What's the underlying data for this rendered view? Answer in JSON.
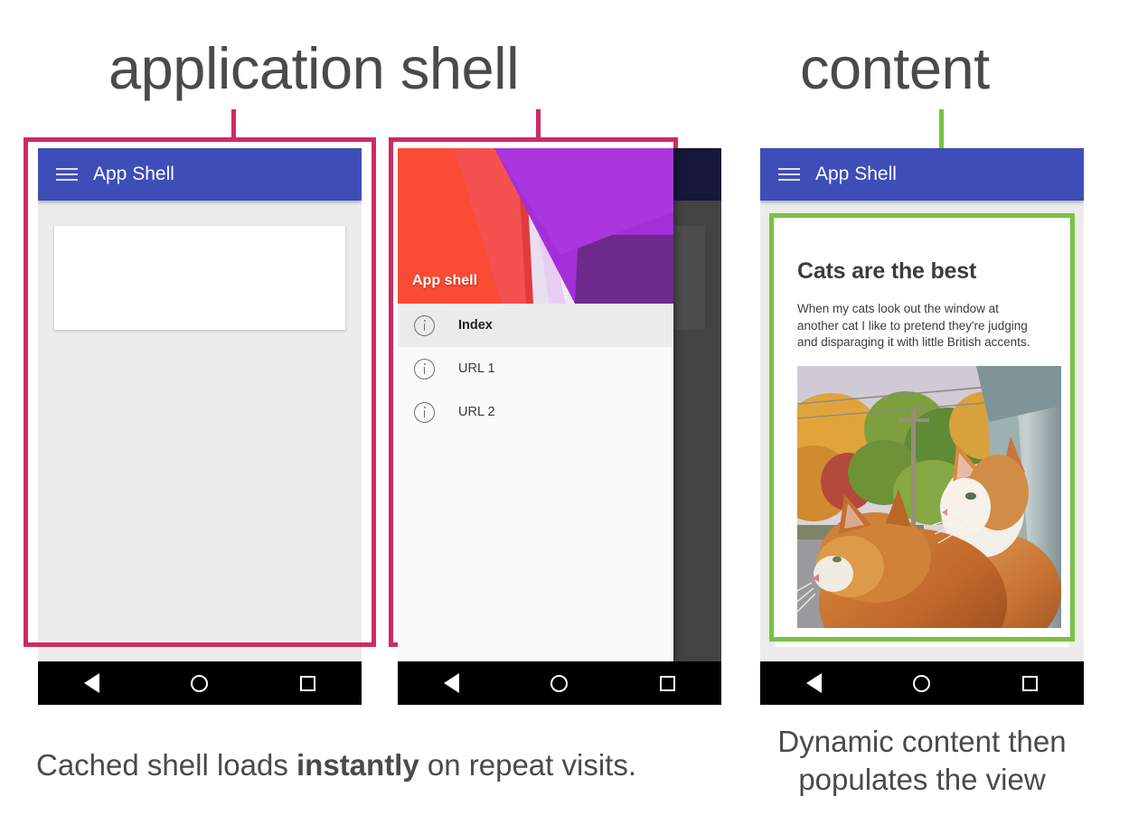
{
  "annotations": {
    "app_shell_label": "application shell",
    "content_label": "content",
    "frame_pink_color": "#ce2a66",
    "frame_green_color": "#79c143"
  },
  "captions": {
    "left_part1": "Cached shell loads ",
    "left_bold": "instantly",
    "left_part2": " on repeat visits.",
    "right": "Dynamic content then populates the view"
  },
  "phone1": {
    "appbar": {
      "title": "App Shell",
      "menu_icon": "hamburger-icon",
      "color": "#3d4eb8"
    },
    "card_placeholder": "",
    "navbar": {
      "back": "back-triangle-icon",
      "home": "home-circle-icon",
      "recents": "square-icon"
    }
  },
  "phone2": {
    "drawer": {
      "header_title": "App shell",
      "items": [
        {
          "label": "Index",
          "icon": "info-circle-icon",
          "active": true
        },
        {
          "label": "URL 1",
          "icon": "info-circle-icon",
          "active": false
        },
        {
          "label": "URL 2",
          "icon": "info-circle-icon",
          "active": false
        }
      ]
    },
    "navbar": {
      "back": "back-triangle-icon",
      "home": "home-circle-icon",
      "recents": "square-icon"
    }
  },
  "phone3": {
    "appbar": {
      "title": "App Shell",
      "menu_icon": "hamburger-icon",
      "color": "#3d4eb8"
    },
    "article": {
      "title": "Cats are the best",
      "body": "When my cats look out the window at another cat I like to pretend they're judging and disparaging it with little British accents.",
      "image_alt": "two orange tabby cats looking out a window"
    },
    "navbar": {
      "back": "back-triangle-icon",
      "home": "home-circle-icon",
      "recents": "square-icon"
    }
  }
}
